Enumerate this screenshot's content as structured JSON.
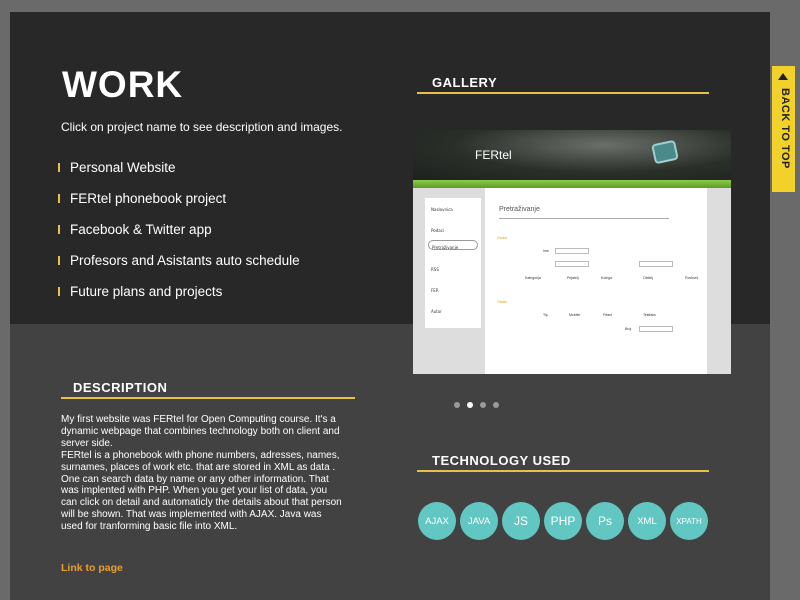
{
  "work": {
    "title": "WORK",
    "subtitle": "Click on project name to see description and images.",
    "projects": [
      "Personal Website",
      "FERtel phonebook project",
      "Facebook & Twitter app",
      "Profesors and Asistants auto schedule",
      "Future plans and projects"
    ]
  },
  "gallery": {
    "heading": "GALLERY",
    "screenshot": {
      "brand": "FERtel",
      "nav_items": [
        "Naslovnica",
        "Podaci",
        "Pretraživanje",
        "RSS",
        "FER",
        "Autor"
      ],
      "section_title": "Pretraživanje",
      "labels": [
        "Osobe",
        "Ime",
        "Kategorija",
        "Prijatelj",
        "Kolega",
        "Obitelj",
        "Poslovni",
        "Ostalo",
        "Tip",
        "Mobitel",
        "Fiksni",
        "Telefaks",
        "Broj"
      ]
    },
    "slides": 4,
    "active_slide": 2
  },
  "description": {
    "heading": "DESCRIPTION",
    "paragraphs": [
      "My first website was FERtel for Open Computing course. It's a dynamic webpage that combines technology both on client and server side.",
      "FERtel is a phonebook with phone numbers, adresses, names, surnames, places of work etc. that are stored in XML as data . One can search data by name or any other information. That was implented with PHP. When you get your list of data, you can click on detail and automaticly the details about that person will be shown. That was implemented with AJAX. Java was used for tranforming basic file into XML."
    ],
    "link": "Link to page"
  },
  "technology": {
    "heading": "TECHNOLOGY USED",
    "items": [
      "AJAX",
      "JAVA",
      "JS",
      "PHP",
      "Ps",
      "XML",
      "XPATH"
    ],
    "color": "#62c7c2"
  },
  "back_to_top": {
    "label": "BACK TO TOP"
  },
  "colors": {
    "accent": "#e6c14a",
    "link": "#e6a030",
    "back_to_top_bg": "#f1d12a"
  }
}
